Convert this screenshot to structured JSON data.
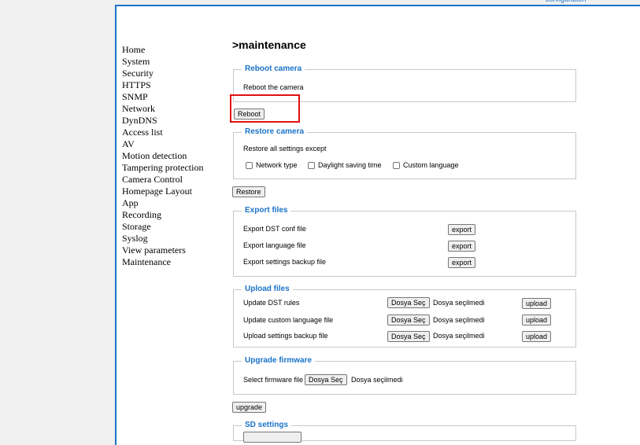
{
  "header": {
    "top_link": "configuration"
  },
  "nav": {
    "items": [
      "Home",
      "System",
      "Security",
      "HTTPS",
      "SNMP",
      "Network",
      "DynDNS",
      "Access list",
      "AV",
      "Motion detection",
      "Tampering protection",
      "Camera Control",
      "Homepage Layout",
      "App",
      "Recording",
      "Storage",
      "Syslog",
      "View parameters",
      "Maintenance"
    ]
  },
  "page": {
    "title": ">maintenance"
  },
  "reboot": {
    "legend": "Reboot camera",
    "text": "Reboot the camera",
    "button": "Reboot"
  },
  "restore": {
    "legend": "Restore camera",
    "text": "Restore all settings except",
    "options": [
      "Network type",
      "Daylight saving time",
      "Custom language"
    ],
    "button": "Restore"
  },
  "export": {
    "legend": "Export files",
    "rows": [
      {
        "label": "Export DST conf file",
        "button": "export"
      },
      {
        "label": "Export language file",
        "button": "export"
      },
      {
        "label": "Export settings backup file",
        "button": "export"
      }
    ]
  },
  "upload": {
    "legend": "Upload files",
    "choose_label": "Dosya Seç",
    "no_file": "Dosya seçilmedi",
    "rows": [
      {
        "label": "Update DST rules",
        "button": "upload"
      },
      {
        "label": "Update custom language file",
        "button": "upload"
      },
      {
        "label": "Upload settings backup file",
        "button": "upload"
      }
    ]
  },
  "upgrade": {
    "legend": "Upgrade firmware",
    "label": "Select firmware file",
    "choose_label": "Dosya Seç",
    "no_file": "Dosya seçilmedi",
    "button": "upgrade"
  },
  "sd": {
    "legend": "SD settings"
  },
  "colors": {
    "accent": "#1a73c8",
    "highlight": "#e01010"
  }
}
